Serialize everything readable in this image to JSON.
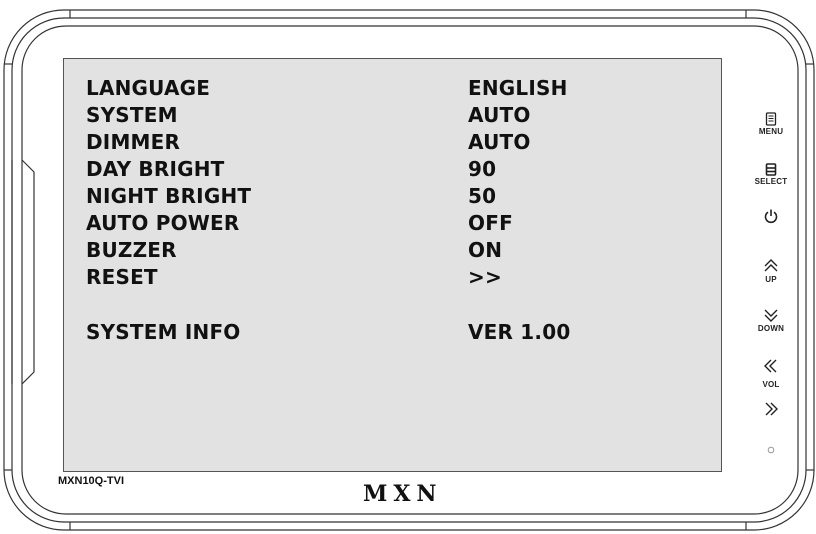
{
  "menu": {
    "items": [
      {
        "label": "LANGUAGE",
        "value": "ENGLISH"
      },
      {
        "label": "SYSTEM",
        "value": "AUTO"
      },
      {
        "label": "DIMMER",
        "value": "AUTO"
      },
      {
        "label": "DAY BRIGHT",
        "value": "90"
      },
      {
        "label": "NIGHT BRIGHT",
        "value": "50"
      },
      {
        "label": "AUTO POWER",
        "value": "OFF"
      },
      {
        "label": "BUZZER",
        "value": "ON"
      },
      {
        "label": "RESET",
        "value": ">>"
      }
    ],
    "info": {
      "label": "SYSTEM INFO",
      "value": "VER 1.00"
    }
  },
  "buttons": {
    "menu_label": "MENU",
    "select_label": "SELECT",
    "up_label": "UP",
    "down_label": "DOWN",
    "vol_label": "VOL"
  },
  "device": {
    "model": "MXN10Q-TVI",
    "brand": "MXN"
  },
  "colors": {
    "screen_bg": "#e2e2e2",
    "text": "#111111",
    "bezel_line": "#333333"
  }
}
